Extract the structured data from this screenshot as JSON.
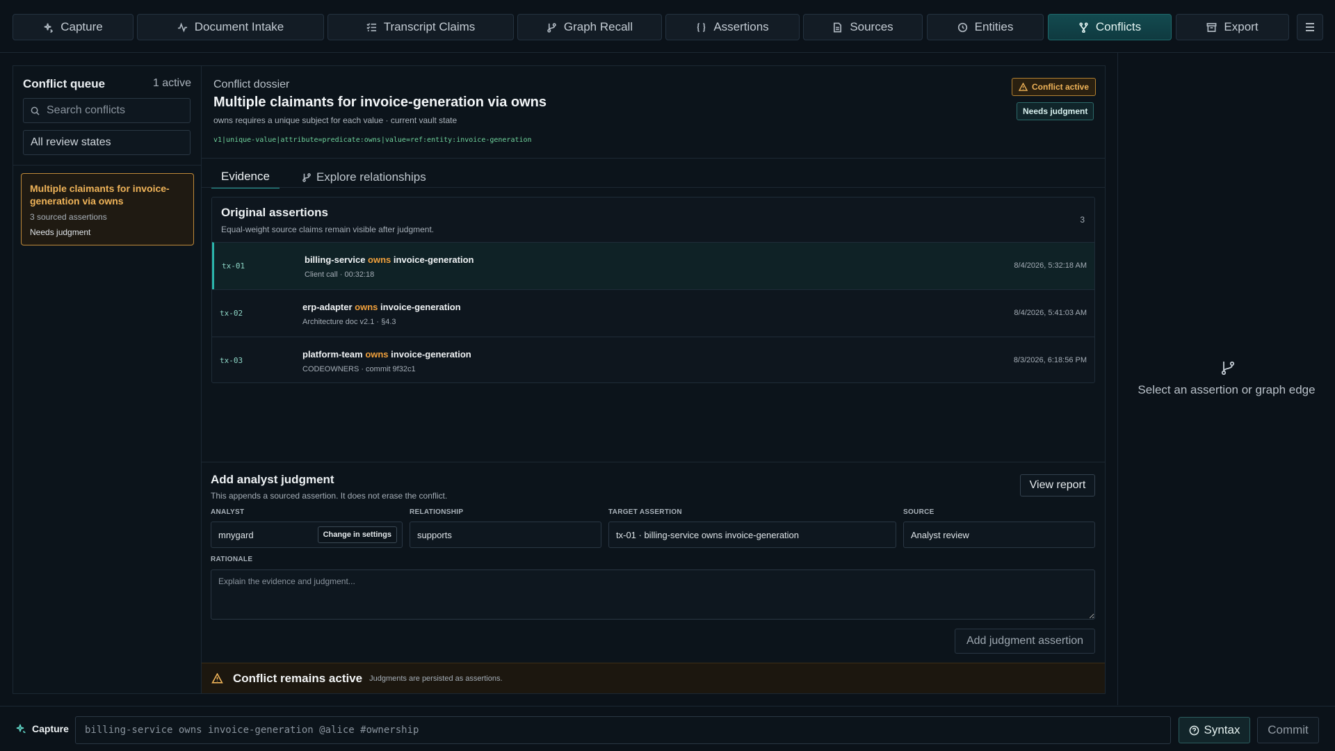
{
  "nav": {
    "tabs": [
      {
        "label": "Capture",
        "icon": "sparkle-icon"
      },
      {
        "label": "Document Intake",
        "icon": "activity-icon"
      },
      {
        "label": "Transcript Claims",
        "icon": "list-checks-icon"
      },
      {
        "label": "Graph Recall",
        "icon": "git-branch-icon"
      },
      {
        "label": "Assertions",
        "icon": "braces-icon"
      },
      {
        "label": "Sources",
        "icon": "file-icon"
      },
      {
        "label": "Entities",
        "icon": "circle-icon"
      },
      {
        "label": "Conflicts",
        "icon": "git-fork-icon"
      },
      {
        "label": "Export",
        "icon": "archive-icon"
      }
    ],
    "active_tab": "Conflicts",
    "menu_icon": "hamburger-icon"
  },
  "sidebar": {
    "title": "Conflict queue",
    "count": "1 active",
    "search_placeholder": "Search conflicts",
    "filter_value": "All review states",
    "items": [
      {
        "title": "Multiple claimants for invoice-generation via owns",
        "subtitle": "3 sourced assertions",
        "state": "Needs judgment"
      }
    ]
  },
  "dossier": {
    "label": "Conflict dossier",
    "title": "Multiple claimants for invoice-generation via owns",
    "subtitle": "owns requires a unique subject for each value · current vault state",
    "key": "v1|unique-value|attribute=predicate:owns|value=ref:entity:invoice-generation",
    "badge_conflict": "Conflict active",
    "badge_judgment": "Needs judgment",
    "tabs": {
      "evidence": "Evidence",
      "explore": "Explore relationships"
    }
  },
  "assertions": {
    "title": "Original assertions",
    "subtitle": "Equal-weight source claims remain visible after judgment.",
    "count": "3",
    "rows": [
      {
        "id": "tx-01",
        "subject": "billing-service",
        "predicate": "owns",
        "object": "invoice-generation",
        "source": "Client call · 00:32:18",
        "time": "8/4/2026, 5:32:18 AM",
        "selected": true
      },
      {
        "id": "tx-02",
        "subject": "erp-adapter",
        "predicate": "owns",
        "object": "invoice-generation",
        "source": "Architecture doc v2.1 · §4.3",
        "time": "8/4/2026, 5:41:03 AM",
        "selected": false
      },
      {
        "id": "tx-03",
        "subject": "platform-team",
        "predicate": "owns",
        "object": "invoice-generation",
        "source": "CODEOWNERS · commit 9f32c1",
        "time": "8/3/2026, 6:18:56 PM",
        "selected": false
      }
    ]
  },
  "judgment": {
    "title": "Add analyst judgment",
    "subtitle": "This appends a sourced assertion. It does not erase the conflict.",
    "view_report": "View report",
    "labels": {
      "analyst": "ANALYST",
      "relationship": "RELATIONSHIP",
      "target": "TARGET ASSERTION",
      "source": "SOURCE",
      "rationale": "RATIONALE"
    },
    "analyst_value": "mnygard",
    "change_label": "Change in settings",
    "relationship_value": "supports",
    "target_value": "tx-01 · billing-service owns invoice-generation",
    "source_value": "Analyst review",
    "rationale_placeholder": "Explain the evidence and judgment...",
    "submit_label": "Add judgment assertion"
  },
  "banner": {
    "title": "Conflict remains active",
    "subtitle": "Judgments are persisted as assertions."
  },
  "detail": {
    "empty_text": "Select an assertion or graph edge",
    "icon": "git-branch-icon"
  },
  "capture_bar": {
    "label": "Capture",
    "placeholder": "billing-service owns invoice-generation @alice #ownership",
    "syntax_label": "Syntax",
    "commit_label": "Commit"
  },
  "colors": {
    "accent_teal": "#2bb5ab",
    "warning_amber": "#f0b459",
    "predicate_orange": "#f0a03c",
    "background": "#0b1219"
  }
}
